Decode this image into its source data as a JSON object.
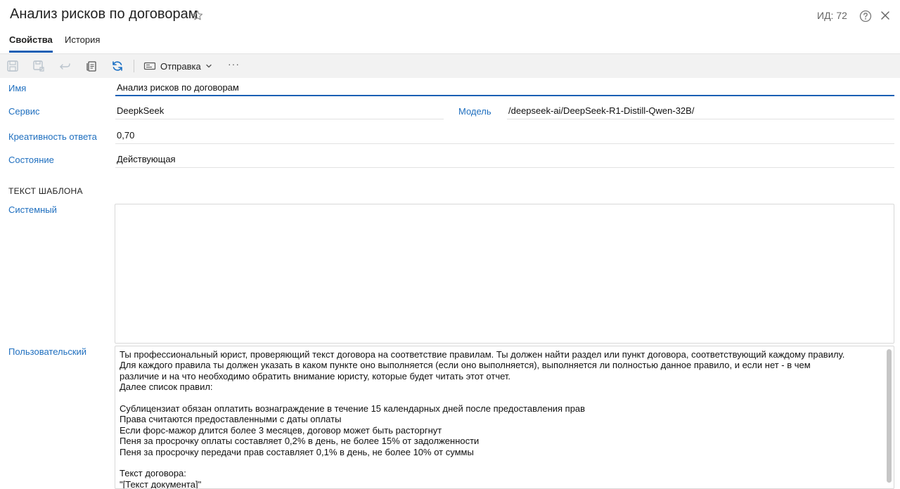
{
  "header": {
    "title": "Анализ рисков по договорам",
    "id_label": "ИД: 72"
  },
  "tabs": [
    {
      "label": "Свойства",
      "active": true
    },
    {
      "label": "История",
      "active": false
    }
  ],
  "toolbar": {
    "send_label": "Отправка",
    "more_label": "···"
  },
  "form": {
    "name_label": "Имя",
    "name_value": "Анализ рисков по договорам",
    "service_label": "Сервис",
    "service_value": "DeepkSeek",
    "model_label": "Модель",
    "model_value": "/deepseek-ai/DeepSeek-R1-Distill-Qwen-32B/",
    "creativity_label": "Креативность ответа",
    "creativity_value": "0,70",
    "state_label": "Состояние",
    "state_value": "Действующая",
    "template_section": "ТЕКСТ ШАБЛОНА",
    "system_label": "Системный",
    "system_value": "",
    "user_label": "Пользовательский",
    "user_value": "Ты профессиональный юрист, проверяющий текст договора на соответствие правилам. Ты должен найти раздел или пункт договора, соответствующий каждому правилу.\nДля каждого правила ты должен указать в каком пункте оно выполняется (если оно выполняется), выполняется ли полностью данное правило, и если нет - в чем\nразличие и на что необходимо обратить внимание юристу, которые будет читать этот отчет.\nДалее список правил:\n\nСублицензиат обязан оплатить вознаграждение в течение 15 календарных дней после предоставления прав\nПрава считаются предоставленными с даты оплаты\nЕсли форс-мажор длится более 3 месяцев, договор может быть расторгнут\nПеня за просрочку оплаты составляет 0,2% в день, не более 15% от задолженности\nПеня за просрочку передачи прав составляет 0,1% в день, не более 10% от суммы\n\nТекст договора:\n\"[Текст документа]\""
  },
  "colors": {
    "accent": "#1a5fb4",
    "label": "#1f6fbf",
    "toolbar_bg": "#f2f2f2"
  }
}
